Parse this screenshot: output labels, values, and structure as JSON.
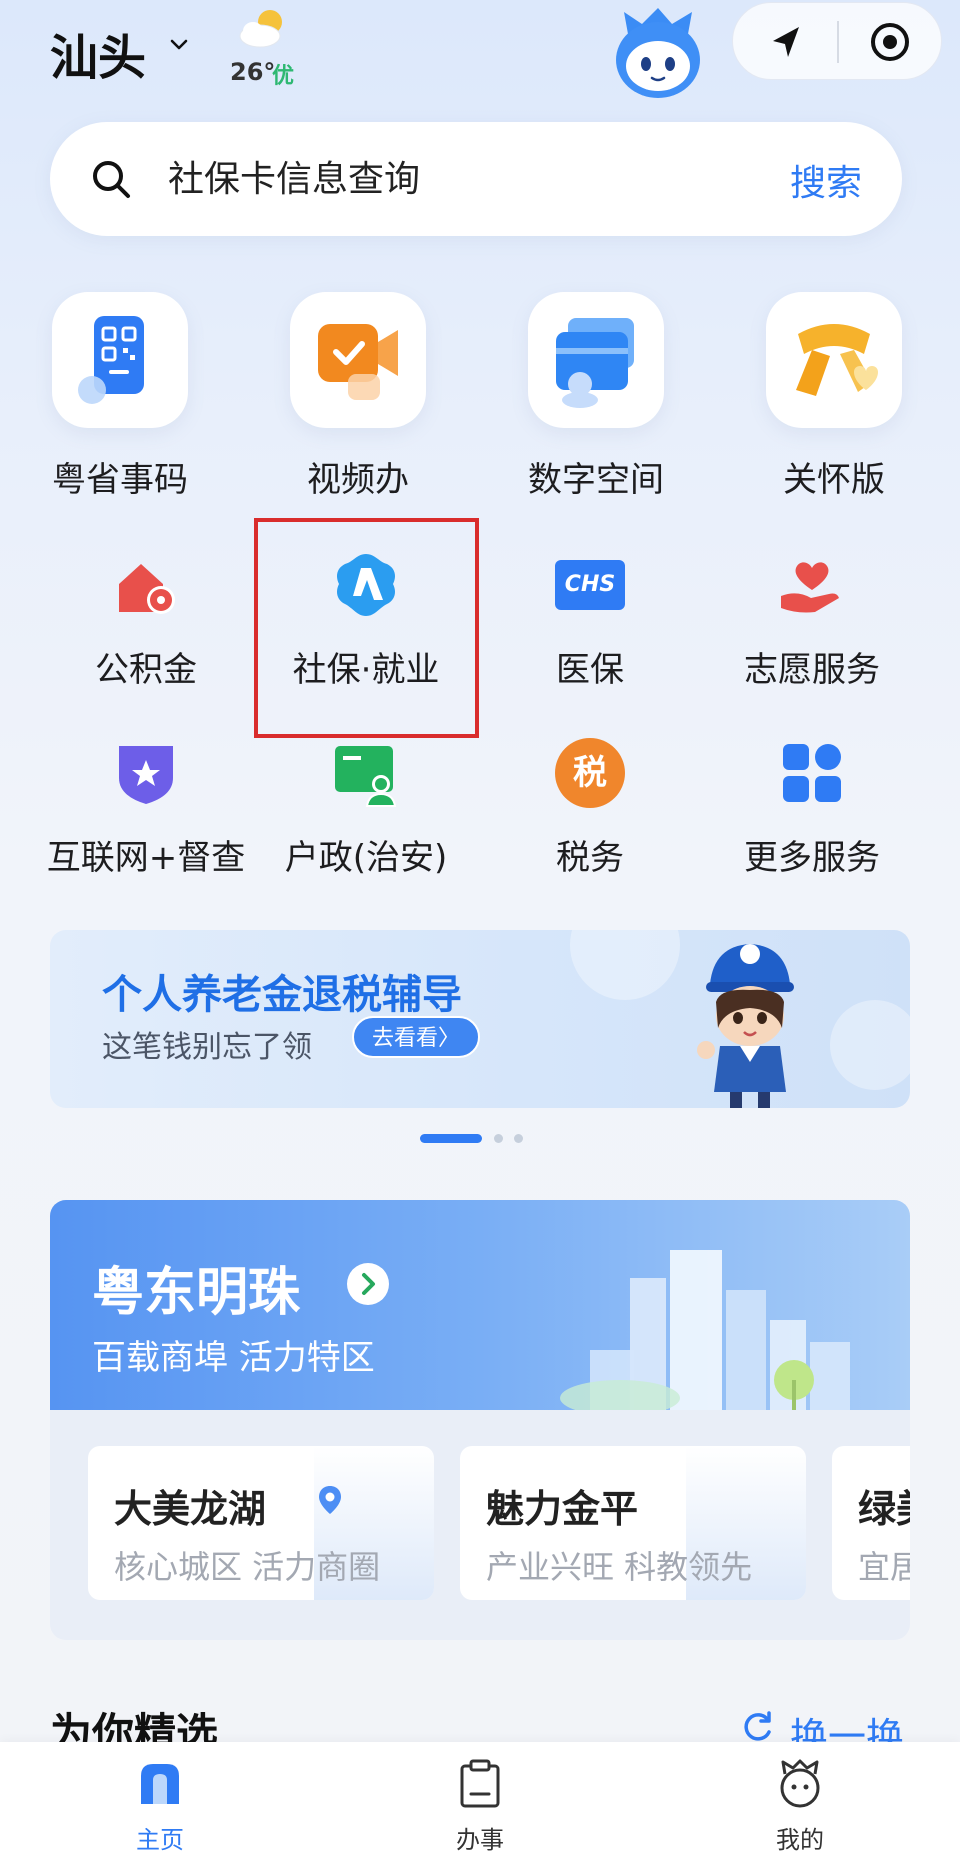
{
  "header": {
    "city": "汕头",
    "weather": {
      "temperature": "26°",
      "air_quality": "优"
    }
  },
  "search": {
    "placeholder": "社保卡信息查询",
    "button": "搜索"
  },
  "services": [
    {
      "label": "粤省事码",
      "icon": "qr-code-icon"
    },
    {
      "label": "视频办",
      "icon": "video-camera-icon"
    },
    {
      "label": "数字空间",
      "icon": "folder-icon"
    },
    {
      "label": "关怀版",
      "icon": "scarf-icon"
    },
    {
      "label": "公积金",
      "icon": "house-fund-icon"
    },
    {
      "label": "社保·就业",
      "icon": "social-security-icon"
    },
    {
      "label": "医保",
      "icon": "chs-icon",
      "icon_text": "CHS"
    },
    {
      "label": "志愿服务",
      "icon": "volunteer-heart-icon"
    },
    {
      "label": "互联网+督查",
      "icon": "shield-star-icon"
    },
    {
      "label": "户政(治安)",
      "icon": "id-card-icon"
    },
    {
      "label": "税务",
      "icon": "tax-icon",
      "icon_text": "税"
    },
    {
      "label": "更多服务",
      "icon": "grid-icon"
    }
  ],
  "highlight": {
    "color": "#d92c2c",
    "target": "社保·就业"
  },
  "banner": {
    "title": "个人养老金退税辅导",
    "subtitle": "这笔钱别忘了领",
    "button": "去看看〉",
    "carousel_total": 3,
    "carousel_active": 1
  },
  "city_card": {
    "title": "粤东明珠",
    "subtitle": "百载商埠  活力特区",
    "districts": [
      {
        "name": "大美龙湖",
        "desc": "核心城区  活力商圈"
      },
      {
        "name": "魅力金平",
        "desc": "产业兴旺  科教领先"
      },
      {
        "name": "绿美",
        "desc": "宜居"
      }
    ]
  },
  "section": {
    "title": "为你精选",
    "refresh": "换一换"
  },
  "tabbar": [
    {
      "label": "主页",
      "icon": "home-icon",
      "active": true
    },
    {
      "label": "办事",
      "icon": "clipboard-icon",
      "active": false
    },
    {
      "label": "我的",
      "icon": "profile-mascot-icon",
      "active": false
    }
  ],
  "colors": {
    "accent": "#2f7bf4",
    "highlight": "#d92c2c",
    "aqi_good": "#2eb872"
  }
}
